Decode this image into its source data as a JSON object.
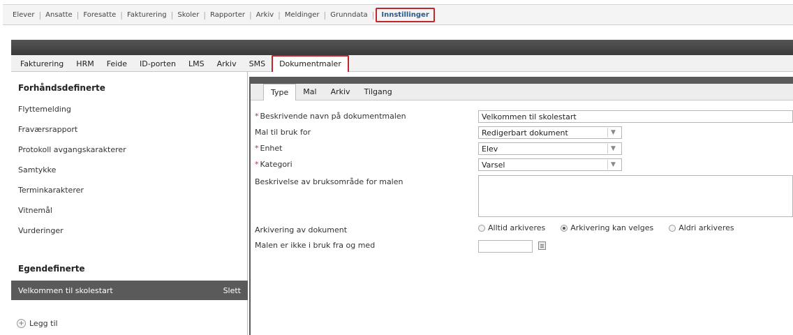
{
  "topnav": {
    "items": [
      "Elever",
      "Ansatte",
      "Foresatte",
      "Fakturering",
      "Skoler",
      "Rapporter",
      "Arkiv",
      "Meldinger",
      "Grunndata"
    ],
    "active": "Innstillinger"
  },
  "subtabs": {
    "items": [
      "Fakturering",
      "HRM",
      "Feide",
      "ID-porten",
      "LMS",
      "Arkiv",
      "SMS"
    ],
    "active": "Dokumentmaler"
  },
  "left": {
    "predefined_title": "Forhåndsdefinerte",
    "predefined": [
      "Flyttemelding",
      "Fraværsrapport",
      "Protokoll avgangskarakterer",
      "Samtykke",
      "Terminkarakterer",
      "Vitnemål",
      "Vurderinger"
    ],
    "custom_title": "Egendefinerte",
    "selected": {
      "label": "Velkommen til skolestart",
      "delete_label": "Slett"
    },
    "add_label": "Legg til"
  },
  "inner_tabs": {
    "items": [
      "Type",
      "Mal",
      "Arkiv",
      "Tilgang"
    ],
    "active": "Type"
  },
  "form": {
    "name_label": "Beskrivende navn på dokumentmalen",
    "name_value": "Velkommen til skolestart",
    "usage_label": "Mal til bruk for",
    "usage_value": "Redigerbart dokument",
    "unit_label": "Enhet",
    "unit_value": "Elev",
    "category_label": "Kategori",
    "category_value": "Varsel",
    "description_label": "Beskrivelse av bruksområde for malen",
    "archiving_label": "Arkivering av dokument",
    "archiving_options": [
      "Alltid arkiveres",
      "Arkivering kan velges",
      "Aldri arkiveres"
    ],
    "archiving_selected": "Arkivering kan velges",
    "inactive_label": "Malen er ikke i bruk fra og med",
    "required_mark": "*"
  },
  "colors": {
    "highlight": "#c0262c",
    "active_nav": "#2a5a8c",
    "selected_row": "#5a5a5a"
  }
}
